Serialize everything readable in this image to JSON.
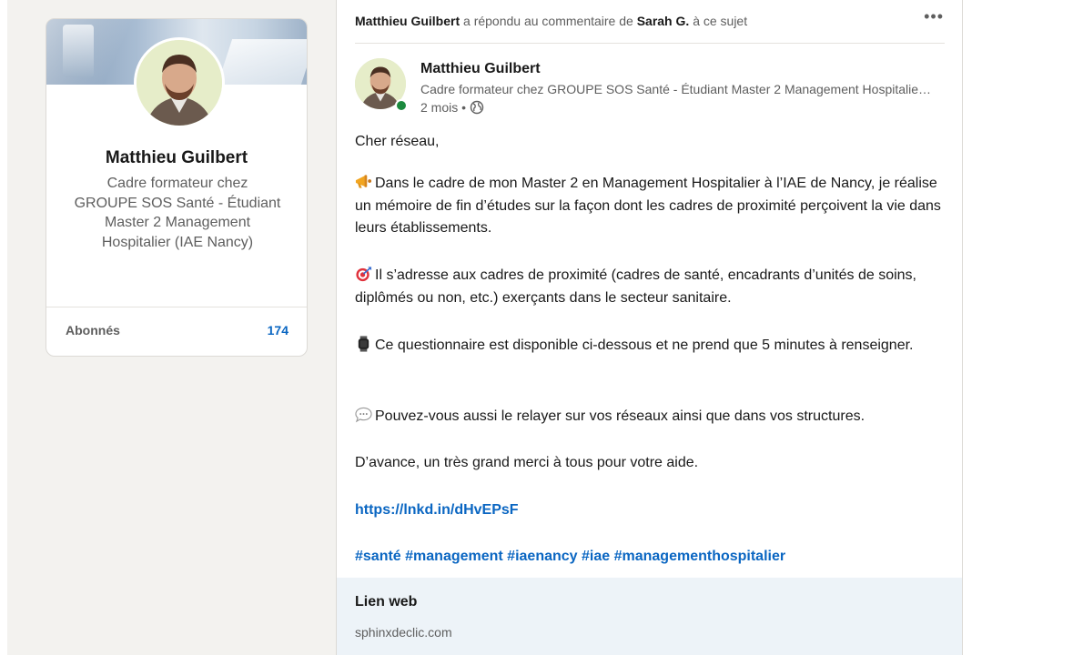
{
  "profile": {
    "name": "Matthieu Guilbert",
    "headline": "Cadre formateur chez GROUPE SOS Santé - Étudiant Master 2 Management Hospitalier (IAE Nancy)",
    "followers_label": "Abonnés",
    "followers_count": "174"
  },
  "post": {
    "activity": {
      "actor": "Matthieu Guilbert",
      "action": "a répondu au commentaire de",
      "target": "Sarah G.",
      "suffix": "à ce sujet"
    },
    "more_icon": "•••",
    "author": {
      "name": "Matthieu Guilbert",
      "headline": "Cadre formateur chez GROUPE SOS Santé - Étudiant Master 2 Management Hospitalier (IAE Nancy)",
      "time": "2 mois •",
      "visibility_icon": "globe-icon",
      "status_color": "#1b8a3e"
    },
    "body": {
      "greeting": "Cher réseau,",
      "p1": "Dans le cadre de mon Master 2 en Management Hospitalier à l’IAE de Nancy, je réalise un mémoire de fin d’études sur la façon dont les cadres de proximité perçoivent la vie dans leurs établissements.",
      "p2": "Il s’adresse aux cadres de proximité (cadres de santé, encadrants d’unités de soins, diplômés ou non, etc.) exerçants dans le secteur sanitaire.",
      "p3": "Ce questionnaire est disponible ci-dessous et ne prend que 5 minutes à renseigner.",
      "p4": "Pouvez-vous aussi le relayer sur vos réseaux ainsi que dans vos structures.",
      "p5": "D’avance, un très grand merci à tous pour votre aide.",
      "url": "https://lnkd.in/dHvEPsF",
      "hashtags": "#santé #management #iaenancy #iae #managementhospitalier"
    },
    "link_preview": {
      "title": "Lien web",
      "domain": "sphinxdeclic.com"
    }
  },
  "colors": {
    "accent": "#0a66c2",
    "page_bg": "#f3f2ef",
    "preview_bg": "#edf3f8"
  }
}
